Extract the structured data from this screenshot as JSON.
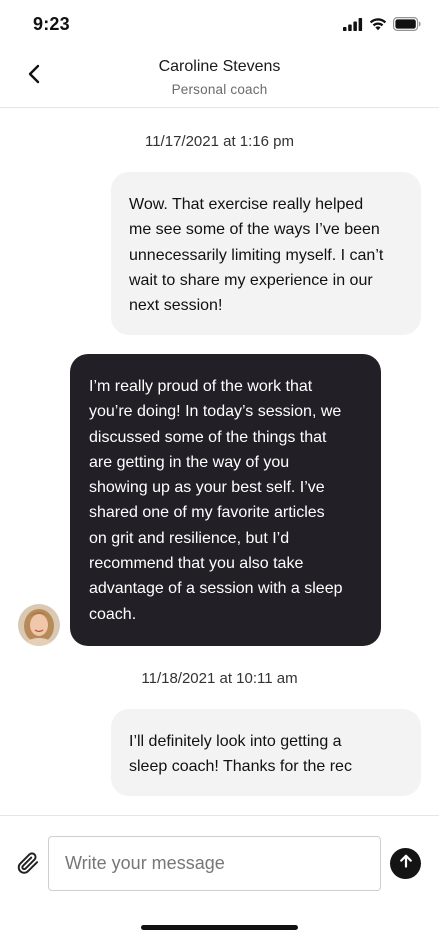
{
  "status_bar": {
    "time": "9:23",
    "icons": [
      "cellular-signal-icon",
      "wifi-icon",
      "battery-icon"
    ]
  },
  "header": {
    "back_icon": "chevron-left-icon",
    "title": "Caroline Stevens",
    "subtitle": "Personal coach"
  },
  "conversation": {
    "timestamps": [
      "11/17/2021 at 1:16 pm",
      "11/18/2021 at 10:11 am"
    ],
    "messages": [
      {
        "direction": "outgoing",
        "lines": [
          "Wow. That exercise really helped",
          "me see some of the ways I’ve been",
          "unnecessarily limiting myself. I can’t",
          "wait to share my experience in our",
          "next session!"
        ]
      },
      {
        "direction": "incoming",
        "sender_avatar": "avatar",
        "lines": [
          "I’m really proud of the work that",
          "you’re doing! In today’s session, we",
          "discussed some of the things that",
          "are getting in the way of you",
          "showing up as your best self. I’ve",
          "shared one of my favorite articles",
          "on grit and resilience, but I’d",
          "recommend that you also take",
          "advantage of a session with a sleep",
          "coach."
        ]
      },
      {
        "direction": "outgoing",
        "lines": [
          "I’ll definitely look into getting a",
          "sleep coach! Thanks for the rec"
        ]
      }
    ]
  },
  "composer": {
    "attach_icon": "paperclip-icon",
    "placeholder": "Write your message",
    "value": "",
    "send_icon": "arrow-up-icon"
  },
  "colors": {
    "incoming_bubble": "#221f27",
    "outgoing_bubble": "#f3f3f3",
    "send_button": "#141414"
  }
}
